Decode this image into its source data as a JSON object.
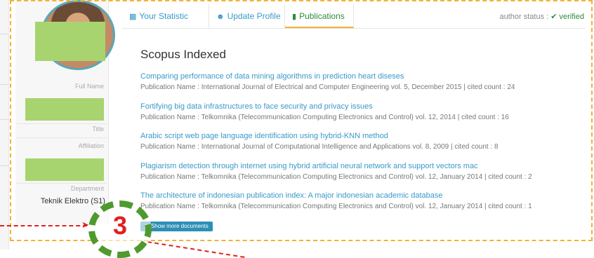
{
  "tabs": [
    {
      "label": "Your Statistic",
      "icon": "bar-chart-icon",
      "active": false
    },
    {
      "label": "Update Profile",
      "icon": "user-icon",
      "active": false
    },
    {
      "label": "Publications",
      "icon": "book-icon",
      "active": true
    }
  ],
  "author_status": {
    "label": "author status :",
    "value": "verified"
  },
  "profile": {
    "full_name_label": "Full Name",
    "title_label": "Title",
    "affiliation_label": "Affiliation",
    "department_label": "Department",
    "department_value": "Teknik Elektro (S1)"
  },
  "section_title": "Scopus Indexed",
  "publications": [
    {
      "title": "Comparing performance of data mining algorithms in prediction heart diseses",
      "meta": "Publication Name : International Journal of Electrical and Computer Engineering vol. 5, December 2015 | cited count : 24"
    },
    {
      "title": "Fortifying big data infrastructures to face security and privacy issues",
      "meta": "Publication Name : Telkomnika (Telecommunication Computing Electronics and Control) vol. 12, 2014 | cited count : 16"
    },
    {
      "title": "Arabic script web page language identification using hybrid-KNN method",
      "meta": "Publication Name : International Journal of Computational Intelligence and Applications vol. 8, 2009 | cited count : 8"
    },
    {
      "title": "Plagiarism detection through internet using hybrid artificial neural network and support vectors mac",
      "meta": "Publication Name : Telkomnika (Telecommunication Computing Electronics and Control) vol. 12, January 2014 | cited count : 2"
    },
    {
      "title": "The architecture of indonesian publication index: A major indonesian academic database",
      "meta": "Publication Name : Telkomnika (Telecommunication Computing Electronics and Control) vol. 12, January 2014 | cited count : 1"
    }
  ],
  "show_more_label": "Show more documents",
  "annotation_number": "3",
  "colors": {
    "link": "#3a99c9",
    "verified": "#2e8b3e",
    "highlight_border": "#f2b233",
    "annotation_red": "#e02020",
    "annotation_green": "#4f9a2f",
    "button": "#2d8fb6"
  }
}
